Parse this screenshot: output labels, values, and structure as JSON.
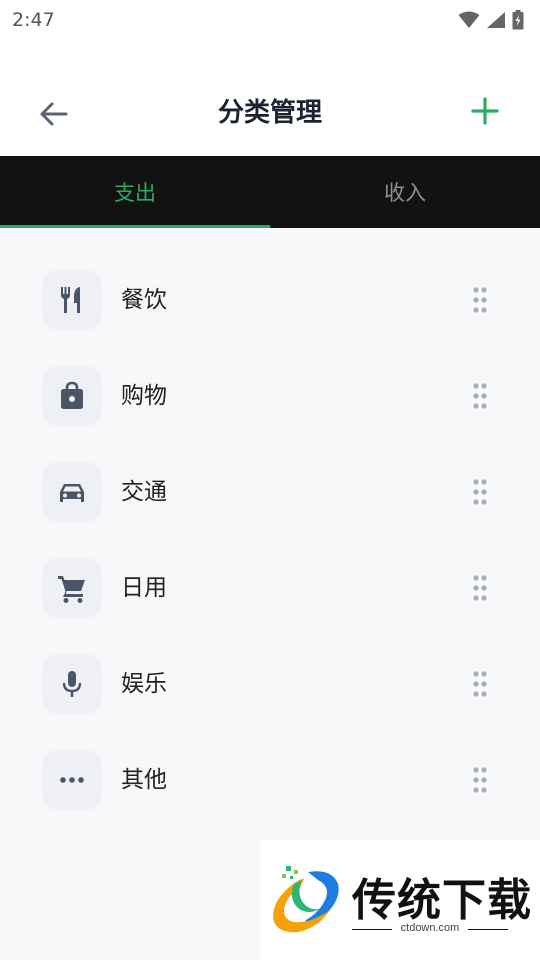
{
  "status_bar": {
    "time": "2:47"
  },
  "header": {
    "title": "分类管理"
  },
  "tabs": [
    {
      "label": "支出",
      "active": true
    },
    {
      "label": "收入",
      "active": false
    }
  ],
  "categories": [
    {
      "label": "餐饮",
      "icon": "utensils-icon"
    },
    {
      "label": "购物",
      "icon": "shopping-bag-icon"
    },
    {
      "label": "交通",
      "icon": "car-icon"
    },
    {
      "label": "日用",
      "icon": "cart-icon"
    },
    {
      "label": "娱乐",
      "icon": "microphone-icon"
    },
    {
      "label": "其他",
      "icon": "more-dots-icon"
    }
  ],
  "watermark": {
    "title": "传统下载",
    "subtitle": "ctdown.com"
  },
  "colors": {
    "accent": "#27ae60",
    "tab_bar": "#121212",
    "icon": "#4a5568",
    "background": "#f7f8fa"
  }
}
